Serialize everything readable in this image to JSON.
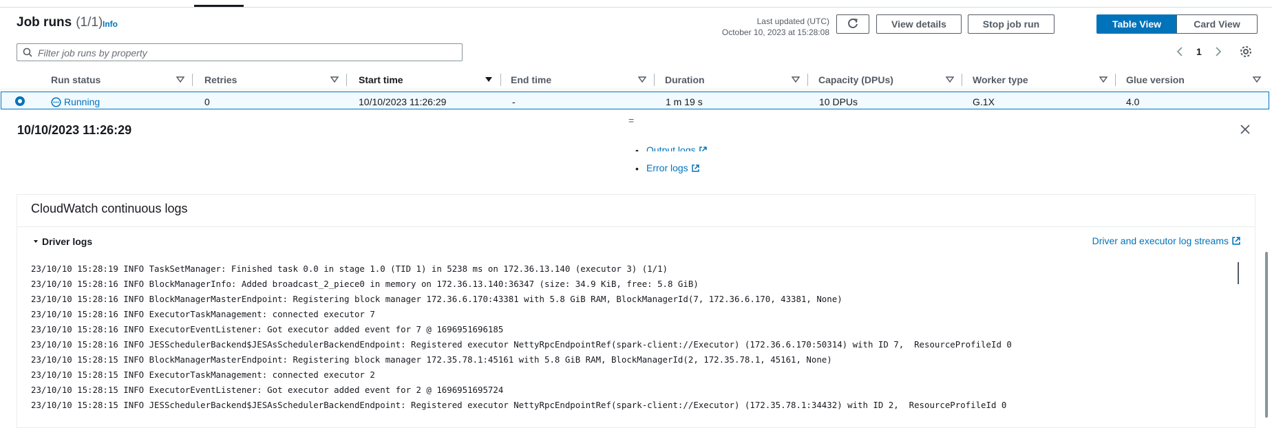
{
  "header": {
    "title": "Job runs",
    "count": "(1/1)",
    "info": "Info",
    "last_updated_label": "Last updated (UTC)",
    "last_updated_value": "October 10, 2023 at 15:28:08",
    "buttons": {
      "refresh_icon": "refresh-icon",
      "view_details": "View details",
      "stop_job_run": "Stop job run",
      "table_view": "Table View",
      "card_view": "Card View"
    }
  },
  "filter": {
    "placeholder": "Filter job runs by property"
  },
  "pagination": {
    "current_page": "1"
  },
  "table": {
    "columns": [
      "Run status",
      "Retries",
      "Start time",
      "End time",
      "Duration",
      "Capacity (DPUs)",
      "Worker type",
      "Glue version"
    ],
    "rows": [
      {
        "run_status": "Running",
        "retries": "0",
        "start_time": "10/10/2023 11:26:29",
        "end_time": "-",
        "duration": "1 m 19 s",
        "capacity": "10 DPUs",
        "worker_type": "G.1X",
        "glue_version": "4.0"
      }
    ]
  },
  "split_panel": {
    "handle": "=",
    "title": "10/10/2023 11:26:29",
    "links": {
      "output_logs": "Output logs",
      "error_logs": "Error logs"
    },
    "cloudwatch": {
      "title": "CloudWatch continuous logs",
      "driver_logs": "Driver logs",
      "streams_link": "Driver and executor log streams",
      "log_lines": [
        "23/10/10 15:28:19 INFO TaskSetManager: Finished task 0.0 in stage 1.0 (TID 1) in 5238 ms on 172.36.13.140 (executor 3) (1/1)",
        "23/10/10 15:28:16 INFO BlockManagerInfo: Added broadcast_2_piece0 in memory on 172.36.13.140:36347 (size: 34.9 KiB, free: 5.8 GiB)",
        "23/10/10 15:28:16 INFO BlockManagerMasterEndpoint: Registering block manager 172.36.6.170:43381 with 5.8 GiB RAM, BlockManagerId(7, 172.36.6.170, 43381, None)",
        "23/10/10 15:28:16 INFO ExecutorTaskManagement: connected executor 7",
        "23/10/10 15:28:16 INFO ExecutorEventListener: Got executor added event for 7 @ 1696951696185",
        "23/10/10 15:28:16 INFO JESSchedulerBackend$JESAsSchedulerBackendEndpoint: Registered executor NettyRpcEndpointRef(spark-client://Executor) (172.36.6.170:50314) with ID 7,  ResourceProfileId 0",
        "23/10/10 15:28:15 INFO BlockManagerMasterEndpoint: Registering block manager 172.35.78.1:45161 with 5.8 GiB RAM, BlockManagerId(2, 172.35.78.1, 45161, None)",
        "23/10/10 15:28:15 INFO ExecutorTaskManagement: connected executor 2",
        "23/10/10 15:28:15 INFO ExecutorEventListener: Got executor added event for 2 @ 1696951695724",
        "23/10/10 15:28:15 INFO JESSchedulerBackend$JESAsSchedulerBackendEndpoint: Registered executor NettyRpcEndpointRef(spark-client://Executor) (172.35.78.1:34432) with ID 2,  ResourceProfileId 0"
      ]
    }
  },
  "colors": {
    "accent": "#0073bb",
    "text": "#16191f",
    "muted": "#545b64",
    "border": "#eaeded"
  }
}
